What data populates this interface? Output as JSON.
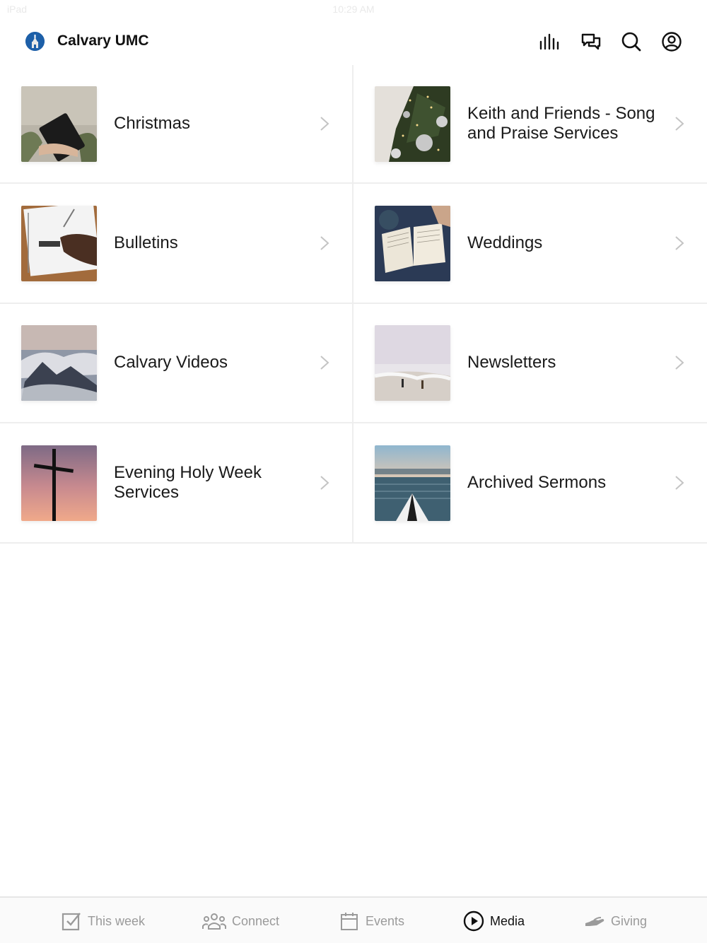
{
  "status_bar": {
    "device": "iPad",
    "time": "10:29 AM"
  },
  "header": {
    "title": "Calvary UMC",
    "actions": [
      {
        "name": "audio-icon"
      },
      {
        "name": "chat-icon"
      },
      {
        "name": "search-icon"
      },
      {
        "name": "profile-icon"
      }
    ]
  },
  "collections": [
    {
      "label": "Christmas",
      "image": "bible-held-photo"
    },
    {
      "label": "Keith and Friends - Song and Praise Services",
      "image": "christmas-tree-photo"
    },
    {
      "label": "Bulletins",
      "image": "notebook-writing-photo"
    },
    {
      "label": "Weddings",
      "image": "open-bible-photo"
    },
    {
      "label": "Calvary Videos",
      "image": "mountain-clouds-photo"
    },
    {
      "label": "Newsletters",
      "image": "beach-runners-photo"
    },
    {
      "label": "Evening Holy Week Services",
      "image": "cross-sunset-photo"
    },
    {
      "label": "Archived Sermons",
      "image": "kayak-lake-photo"
    }
  ],
  "tabbar": {
    "tabs": [
      {
        "label": "This week",
        "icon": "checkbox-icon",
        "active": false
      },
      {
        "label": "Connect",
        "icon": "people-icon",
        "active": false
      },
      {
        "label": "Events",
        "icon": "calendar-icon",
        "active": false
      },
      {
        "label": "Media",
        "icon": "play-circle-icon",
        "active": true
      },
      {
        "label": "Giving",
        "icon": "giving-hand-icon",
        "active": false
      }
    ]
  },
  "colors": {
    "active_tab": "#111111",
    "inactive_tab": "#9a9a9a",
    "divider": "#eeeeee",
    "logo_blue": "#1d5fa8"
  }
}
